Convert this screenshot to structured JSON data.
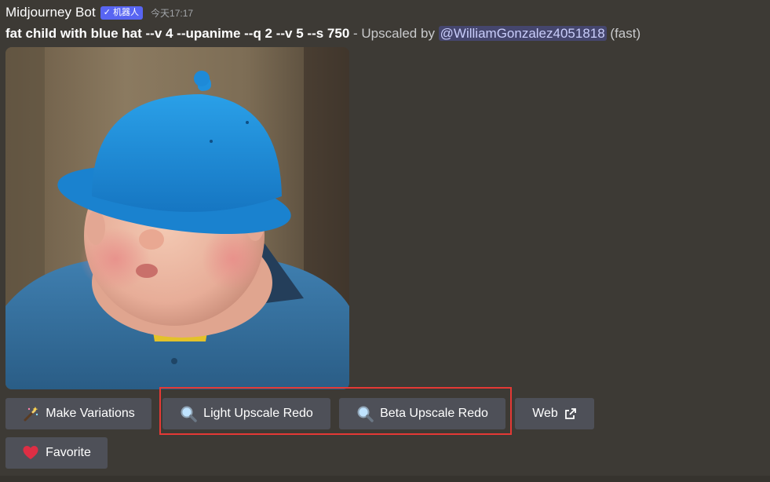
{
  "message": {
    "author": "Midjourney Bot",
    "bot_tag": "机器人",
    "timestamp": "今天17:17",
    "prompt": "fat child with blue hat --v 4 --upanime --q 2 --v 5 --s 750",
    "separator": " - Upscaled by ",
    "mention": "@WilliamGonzalez4051818",
    "mode": " (fast)"
  },
  "image": {
    "alt": "fat child with blue hat"
  },
  "buttons": {
    "make_variations": {
      "label": "Make Variations",
      "icon": "magic-wand-icon"
    },
    "light_upscale_redo": {
      "label": "Light Upscale Redo",
      "icon": "magnifier-icon"
    },
    "beta_upscale_redo": {
      "label": "Beta Upscale Redo",
      "icon": "magnifier-icon"
    },
    "web": {
      "label": "Web",
      "icon": "external-link-icon"
    },
    "favorite": {
      "label": "Favorite",
      "icon": "heart-icon"
    }
  },
  "colors": {
    "background": "#3d3a35",
    "button": "#4e5058",
    "bot_tag": "#5865f2",
    "highlight": "#e53935"
  }
}
